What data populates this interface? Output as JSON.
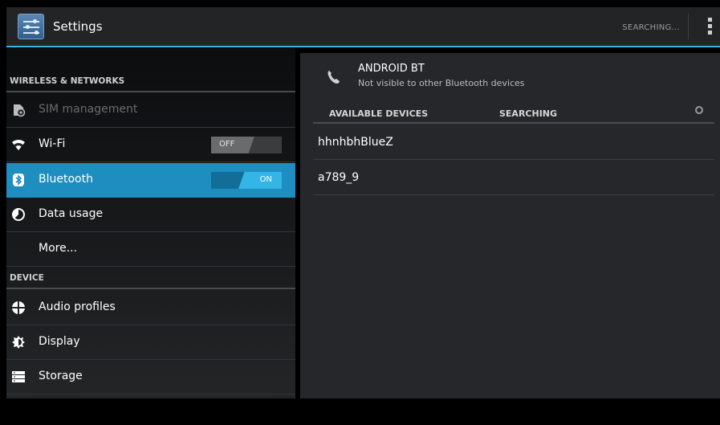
{
  "actionbar": {
    "title": "Settings",
    "status": "SEARCHING...",
    "icon": "settings-sliders-icon",
    "overflow_icon": "overflow-menu-icon"
  },
  "sidebar": {
    "sections": {
      "wireless": "WIRELESS & NETWORKS",
      "device": "DEVICE"
    },
    "items": [
      {
        "label": "SIM management",
        "icon": "sim-management-icon",
        "enabled": false
      },
      {
        "label": "Wi-Fi",
        "icon": "wifi-icon",
        "toggle": "OFF"
      },
      {
        "label": "Bluetooth",
        "icon": "bluetooth-icon",
        "toggle": "ON",
        "selected": true
      },
      {
        "label": "Data usage",
        "icon": "data-usage-icon"
      },
      {
        "label": "More..."
      },
      {
        "label": "Audio profiles",
        "icon": "audio-profiles-icon"
      },
      {
        "label": "Display",
        "icon": "display-icon"
      },
      {
        "label": "Storage",
        "icon": "storage-icon"
      }
    ]
  },
  "bluetooth": {
    "device_name": "ANDROID BT",
    "visibility": "Not visible to other Bluetooth devices",
    "available_header": "AVAILABLE DEVICES",
    "searching_header": "SEARCHING",
    "devices": [
      {
        "name": "hhnhbhBlueZ"
      },
      {
        "name": "a789_9"
      }
    ]
  },
  "colors": {
    "accent": "#33b5e5",
    "selected_row": "#1e8dc0"
  }
}
